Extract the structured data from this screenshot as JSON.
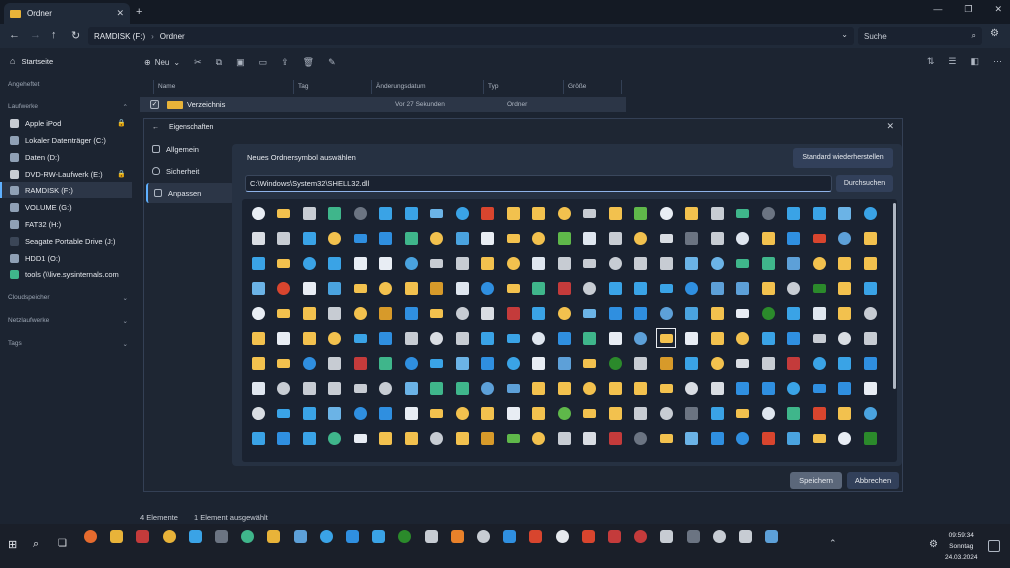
{
  "window": {
    "tab_title": "Ordner",
    "tab_close": "✕",
    "new_tab": "+",
    "controls": [
      "—",
      "❐",
      "✕"
    ]
  },
  "address": {
    "crumbs": [
      "RAMDISK (F:)",
      "Ordner"
    ],
    "search_placeholder": "Suche"
  },
  "sidebar": {
    "home": "Startseite",
    "pinned_header": "Angeheftet",
    "drives_header": "Laufwerke",
    "drives": [
      "Apple iPod",
      "Lokaler Datenträger (C:)",
      "Daten (D:)",
      "DVD-RW-Laufwerk (E:)",
      "RAMDISK (F:)",
      "VOLUME (G:)",
      "FAT32 (H:)",
      "Seagate Portable Drive (J:)",
      "HDD1 (O:)",
      "tools (\\\\live.sysinternals.com"
    ],
    "cloud_header": "Cloudspeicher",
    "network_header": "Netzlaufwerke",
    "tags_header": "Tags"
  },
  "toolbar": {
    "new_label": "Neu"
  },
  "columns": [
    "Name",
    "Tag",
    "Änderungsdatum",
    "Typ",
    "Größe"
  ],
  "file_row": {
    "name": "Verzeichnis",
    "modified": "Vor 27 Sekunden",
    "type": "Ordner"
  },
  "status": {
    "count": "4 Elemente",
    "selected": "1 Element ausgewählt"
  },
  "dialog": {
    "title": "Eigenschaften",
    "nav": [
      "Allgemein",
      "Sicherheit",
      "Anpassen"
    ],
    "pane_label": "Neues Ordnersymbol auswählen",
    "restore_button": "Standard wiederherstellen",
    "path_value": "C:\\Windows\\System32\\SHELL32.dll",
    "browse_button": "Durchsuchen",
    "save_button": "Speichern",
    "cancel_button": "Abbrechen",
    "icon_colors": [
      "#e8edf4",
      "#dfe6ef",
      "#2f8fe0",
      "#f2c14e",
      "#f2c14e",
      "#c7ccd3",
      "#c7ccd3",
      "#d9dde3",
      "#d9dde3",
      "#3fb68b",
      "#c43b3b",
      "#c7ccd3",
      "#6b7482",
      "#2f8fe0",
      "#3aa3e6",
      "#3aa3e6",
      "#c7ccd3",
      "#3aa3e6",
      "#3aa3e6",
      "#f2c14e",
      "#dfe6ef",
      "#6bb3e6",
      "#2f8fe0",
      "#2f8fe0",
      "#3aa3e6",
      "#2f8fe0",
      "#3fb68b",
      "#d8452e",
      "#e8edf4",
      "#e8edf4",
      "#f2c14e",
      "#5da0d8",
      "#5da0d8",
      "#f2c14e",
      "#4aa3df",
      "#f2c14e",
      "#f2c14e",
      "#f2c14e",
      "#e8edf4",
      "#c7ccd3",
      "#2b8a2b",
      "#f2c14e",
      "#f2c14e",
      "#d79a2a",
      "#f2c14e",
      "#5fb84a",
      "#f2c14e",
      "#3aa3e6"
    ],
    "icon_rows": 10,
    "icon_cols": 25
  },
  "taskbar": {
    "time": "09:59:34",
    "day": "Sonntag",
    "date": "24.03.2024"
  }
}
